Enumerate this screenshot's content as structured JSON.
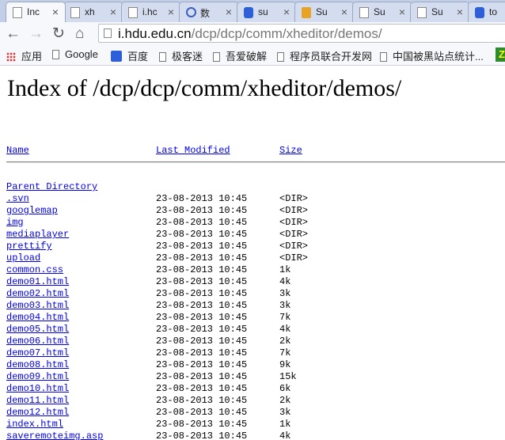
{
  "browser": {
    "tabs": [
      {
        "label": "Inc",
        "favicon": "page-icon",
        "active": true
      },
      {
        "label": "xh",
        "favicon": "page-icon",
        "active": false
      },
      {
        "label": "i.hc",
        "favicon": "page-icon",
        "active": false
      },
      {
        "label": "数",
        "favicon": "swirl-icon",
        "active": false
      },
      {
        "label": "su",
        "favicon": "baidu-paw-icon",
        "active": false
      },
      {
        "label": "Su",
        "favicon": "sogou-icon",
        "active": false
      },
      {
        "label": "Su",
        "favicon": "page-icon",
        "active": false
      },
      {
        "label": "Su",
        "favicon": "page-icon",
        "active": false
      },
      {
        "label": "to",
        "favicon": "baidu-paw-icon",
        "active": false
      }
    ],
    "tab_close_glyph": "×",
    "url_host": "i.hdu.edu.cn",
    "url_path": "/dcp/dcp/comm/xheditor/demos/",
    "bookmarks": [
      {
        "label": "应用",
        "icon": "apps-grid-icon"
      },
      {
        "label": "Google",
        "icon": "page-icon"
      },
      {
        "label": "百度",
        "icon": "baidu-paw-icon"
      },
      {
        "label": "极客迷",
        "icon": "page-icon"
      },
      {
        "label": "吾爱破解",
        "icon": "page-icon"
      },
      {
        "label": "程序员联合开发网",
        "icon": "page-icon"
      },
      {
        "label": "中国被黑站点统计...",
        "icon": "page-icon"
      }
    ],
    "extension_glyph": "Z"
  },
  "page": {
    "title": "Index of /dcp/dcp/comm/xheditor/demos/",
    "headers": {
      "name": "Name",
      "modified": "Last Modified",
      "size": "Size"
    },
    "parent_label": "Parent Directory",
    "entries": [
      {
        "name": ".svn",
        "modified": "23-08-2013 10:45",
        "size": "<DIR>"
      },
      {
        "name": "googlemap",
        "modified": "23-08-2013 10:45",
        "size": "<DIR>"
      },
      {
        "name": "img",
        "modified": "23-08-2013 10:45",
        "size": "<DIR>"
      },
      {
        "name": "mediaplayer",
        "modified": "23-08-2013 10:45",
        "size": "<DIR>"
      },
      {
        "name": "prettify",
        "modified": "23-08-2013 10:45",
        "size": "<DIR>"
      },
      {
        "name": "upload",
        "modified": "23-08-2013 10:45",
        "size": "<DIR>"
      },
      {
        "name": "common.css",
        "modified": "23-08-2013 10:45",
        "size": "1k"
      },
      {
        "name": "demo01.html",
        "modified": "23-08-2013 10:45",
        "size": "4k"
      },
      {
        "name": "demo02.html",
        "modified": "23-08-2013 10:45",
        "size": "3k"
      },
      {
        "name": "demo03.html",
        "modified": "23-08-2013 10:45",
        "size": "3k"
      },
      {
        "name": "demo04.html",
        "modified": "23-08-2013 10:45",
        "size": "7k"
      },
      {
        "name": "demo05.html",
        "modified": "23-08-2013 10:45",
        "size": "4k"
      },
      {
        "name": "demo06.html",
        "modified": "23-08-2013 10:45",
        "size": "2k"
      },
      {
        "name": "demo07.html",
        "modified": "23-08-2013 10:45",
        "size": "7k"
      },
      {
        "name": "demo08.html",
        "modified": "23-08-2013 10:45",
        "size": "9k"
      },
      {
        "name": "demo09.html",
        "modified": "23-08-2013 10:45",
        "size": "15k"
      },
      {
        "name": "demo10.html",
        "modified": "23-08-2013 10:45",
        "size": "6k"
      },
      {
        "name": "demo11.html",
        "modified": "23-08-2013 10:45",
        "size": "2k"
      },
      {
        "name": "demo12.html",
        "modified": "23-08-2013 10:45",
        "size": "3k"
      },
      {
        "name": "index.html",
        "modified": "23-08-2013 10:45",
        "size": "1k"
      },
      {
        "name": "saveremoteimg.asp",
        "modified": "23-08-2013 10:45",
        "size": "4k"
      }
    ]
  },
  "colors": {
    "link": "#0000ee",
    "tab_strip": "#c3cfe6",
    "toolbar": "#f6f8fb"
  }
}
